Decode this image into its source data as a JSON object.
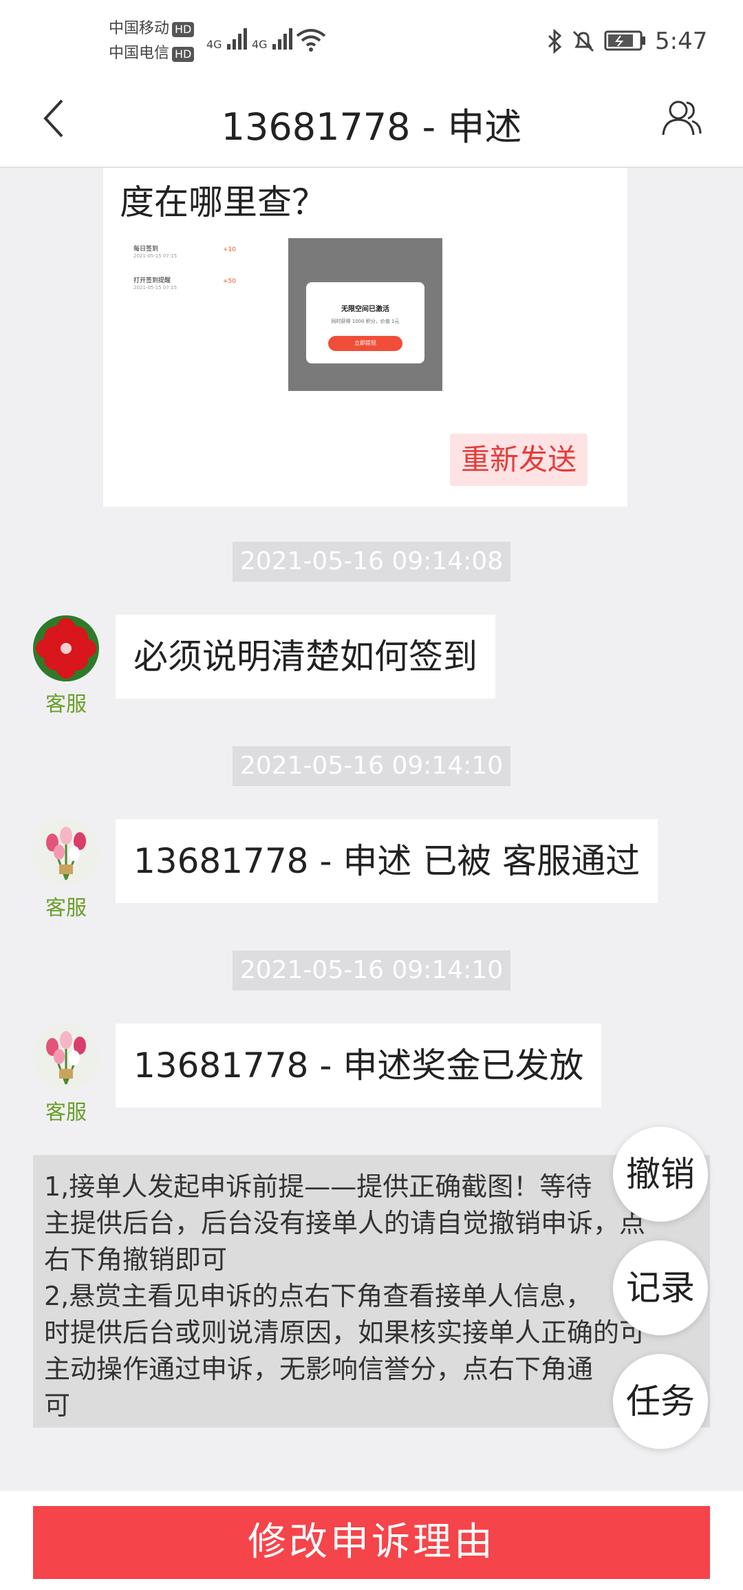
{
  "status_bar": {
    "carrier1": "中国移动",
    "carrier2": "中国电信",
    "hd": "HD",
    "net1": "4G",
    "net2": "4G",
    "time": "5:47"
  },
  "header": {
    "title": "13681778 - 申述"
  },
  "messages": {
    "partial_text": "度在哪里查？",
    "screenshot": {
      "row1_label": "每日签到",
      "row1_date": "2021-05-15 07:15",
      "row1_points": "+10",
      "row2_label": "打开签到提醒",
      "row2_date": "2021-05-15 07:15",
      "row2_points": "+50",
      "popup_title": "无限空间已激活",
      "popup_sub": "同时获得 1000 积分，价值 1元",
      "popup_button": "立即提现"
    },
    "resend_label": "重新发送",
    "items": [
      {
        "time": "2021-05-16 09:14:08",
        "sender": "客服",
        "text": "必须说明清楚如何签到"
      },
      {
        "time": "2021-05-16 09:14:10",
        "sender": "客服",
        "text": "13681778 - 申述 已被 客服通过"
      },
      {
        "time": "2021-05-16 09:14:10",
        "sender": "客服",
        "text": "13681778 - 申述奖金已发放"
      }
    ]
  },
  "notice": {
    "line1": "1,接单人发起申诉前提——提供正确截图！等待",
    "line2": "主提供后台，后台没有接单人的请自觉撤销申诉，点",
    "line3": "右下角撤销即可",
    "line4": "2,悬赏主看见申诉的点右下角查看接单人信息，",
    "line5": "时提供后台或则说清原因，如果核实接单人正确的可",
    "line6": "主动操作通过申诉，无影响信誉分，点右下角通",
    "line7": "可"
  },
  "fabs": {
    "cancel": "撤销",
    "record": "记录",
    "task": "任务"
  },
  "bottom": {
    "button": "修改申诉理由"
  },
  "colors": {
    "accent_red": "#f5444a",
    "sender_green": "#6a9f2a"
  }
}
